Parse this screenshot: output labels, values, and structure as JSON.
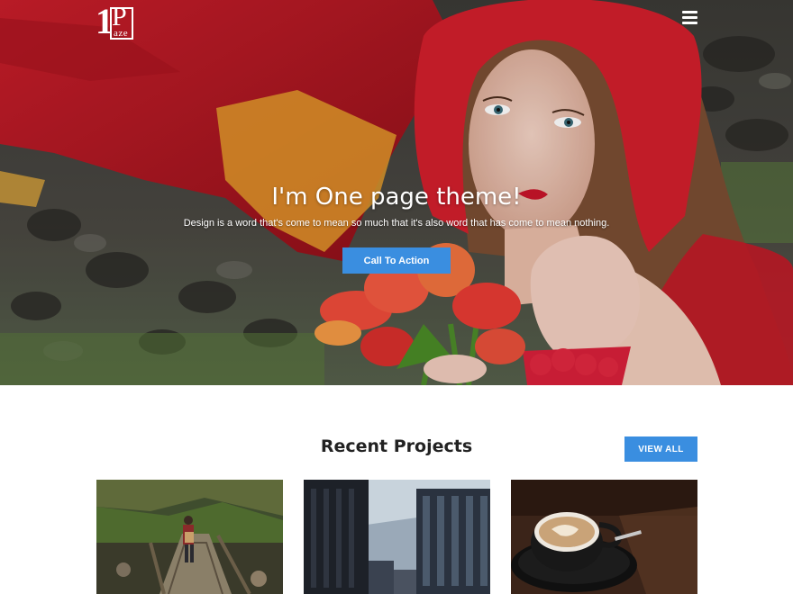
{
  "header": {
    "logo_mark": "1",
    "logo_letter": "P",
    "logo_text": "aze",
    "menu_icon": "hamburger-icon"
  },
  "hero": {
    "title": "I'm One page theme!",
    "subtitle": "Design is a word that's come to mean so much that it's also word that has come to mean nothing.",
    "cta_label": "Call To Action",
    "accent_color": "#3a8ee0"
  },
  "projects": {
    "title": "Recent Projects",
    "view_all_label": "VIEW ALL",
    "items": [
      {
        "image": "hiker-on-bridge-photo"
      },
      {
        "image": "skyscrapers-photo"
      },
      {
        "image": "coffee-cup-photo"
      }
    ]
  }
}
